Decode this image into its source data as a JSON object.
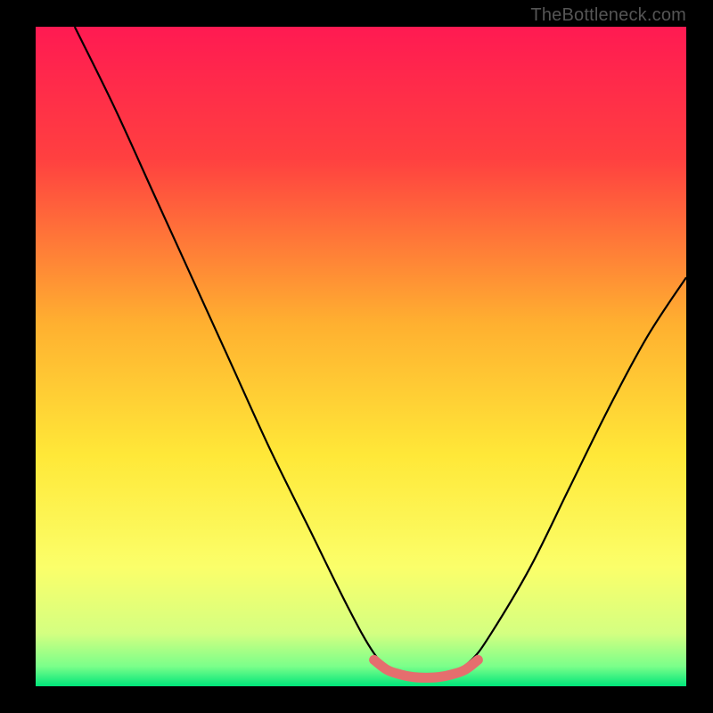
{
  "watermark": "TheBottleneck.com",
  "chart_data": {
    "type": "line",
    "title": "",
    "xlabel": "",
    "ylabel": "",
    "xlim": [
      0,
      100
    ],
    "ylim": [
      0,
      100
    ],
    "series": [
      {
        "name": "bottleneck-curve",
        "x": [
          6,
          12,
          18,
          24,
          30,
          36,
          42,
          48,
          52,
          55,
          58,
          61,
          64,
          67,
          70,
          76,
          82,
          88,
          94,
          100
        ],
        "values": [
          100,
          88,
          75,
          62,
          49,
          36,
          24,
          12,
          5,
          2,
          1,
          1,
          2,
          4,
          8,
          18,
          30,
          42,
          53,
          62
        ]
      },
      {
        "name": "optimum-marker",
        "x": [
          52,
          54,
          56,
          58,
          60,
          62,
          64,
          66,
          68
        ],
        "values": [
          4,
          2.5,
          1.8,
          1.4,
          1.3,
          1.4,
          1.8,
          2.5,
          4
        ]
      }
    ],
    "gradient_stops": [
      {
        "offset": 0,
        "color": "#ff1a52"
      },
      {
        "offset": 0.2,
        "color": "#ff4040"
      },
      {
        "offset": 0.45,
        "color": "#ffb030"
      },
      {
        "offset": 0.65,
        "color": "#ffe838"
      },
      {
        "offset": 0.82,
        "color": "#fbff6a"
      },
      {
        "offset": 0.92,
        "color": "#d4ff81"
      },
      {
        "offset": 0.97,
        "color": "#7aff8a"
      },
      {
        "offset": 1.0,
        "color": "#00e57a"
      }
    ],
    "colors": {
      "curve": "#000000",
      "marker": "#e56e6e",
      "background": "#000000"
    }
  }
}
